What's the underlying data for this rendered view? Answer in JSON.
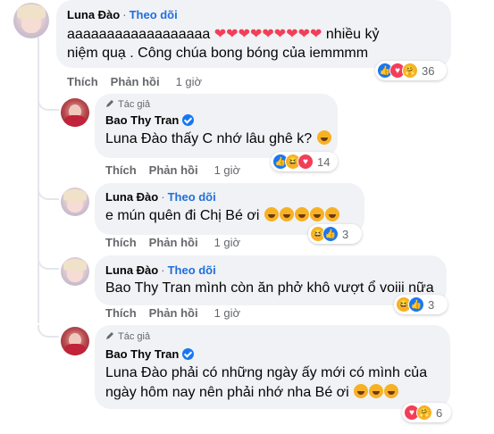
{
  "ui": {
    "follow_label": "Theo dõi",
    "like_label": "Thích",
    "reply_label": "Phản hồi",
    "author_tag": "Tác giả",
    "separator": "·"
  },
  "comments": [
    {
      "author": "Luna Đào",
      "text_line1": "aaaaaaaaaaaaaaaaaa ❤❤❤❤❤❤❤❤❤ nhiều kỷ",
      "text_line2": "niệm quạ . Công chúa bong bóng của iemmmm",
      "time": "1 giờ",
      "reaction_count": "36"
    },
    {
      "author": "Bao Thy Tran",
      "mention": "Luna Đào",
      "text": "thấy C nhớ lâu ghê k?",
      "time": "1 giờ",
      "reaction_count": "14"
    },
    {
      "author": "Luna Đào",
      "text": "e mún quên đi Chị Bé ơi",
      "time": "1 giờ",
      "reaction_count": "3"
    },
    {
      "author": "Luna Đào",
      "mention": "Bao Thy Tran",
      "text": "mình còn ăn phở khô vượt ổ voiii nữa",
      "time": "1 giờ",
      "reaction_count": "3"
    },
    {
      "author": "Bao Thy Tran",
      "mention": "Luna Đào",
      "text_line1": "phải có những ngày ấy mới có mình của",
      "text_line2": "ngày hôm nay nên phải nhớ nha Bé ơi",
      "reaction_count": "6"
    }
  ],
  "icons": {
    "reaction_like": "like-icon",
    "reaction_love": "love-icon",
    "reaction_haha": "haha-icon",
    "reaction_care": "care-icon",
    "verified": "verified-badge-icon",
    "author_pen": "pen-icon"
  },
  "colors": {
    "link_blue": "#216fdb",
    "like_blue": "#1877f2",
    "love_red": "#f33e58",
    "haha_yellow": "#f7b125",
    "bubble_gray": "#f0f2f5",
    "meta_gray": "#65676b"
  }
}
